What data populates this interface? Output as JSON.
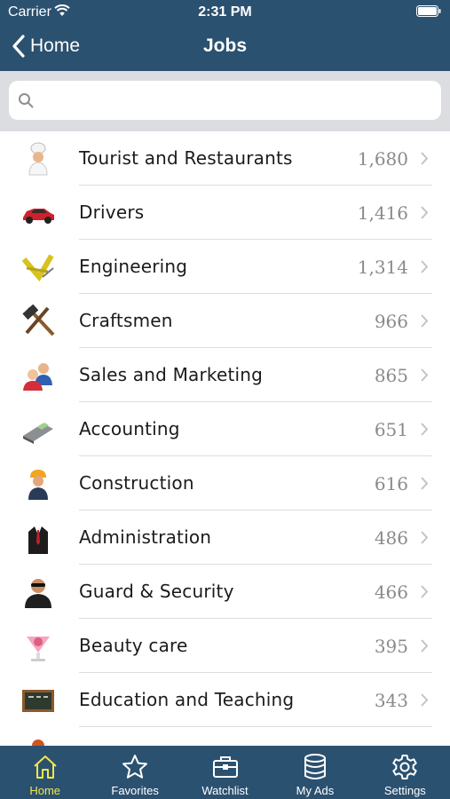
{
  "status": {
    "carrier": "Carrier",
    "time": "2:31 PM"
  },
  "nav": {
    "back_label": "Home",
    "title": "Jobs"
  },
  "search": {
    "placeholder": ""
  },
  "jobs": [
    {
      "label": "Tourist and Restaurants",
      "count": "1,680",
      "icon": "chef-icon"
    },
    {
      "label": "Drivers",
      "count": "1,416",
      "icon": "car-icon"
    },
    {
      "label": "Engineering",
      "count": "1,314",
      "icon": "drafting-tools-icon"
    },
    {
      "label": "Craftsmen",
      "count": "966",
      "icon": "hammer-icon"
    },
    {
      "label": "Sales and Marketing",
      "count": "865",
      "icon": "people-icon"
    },
    {
      "label": "Accounting",
      "count": "651",
      "icon": "calculator-icon"
    },
    {
      "label": "Construction",
      "count": "616",
      "icon": "construction-worker-icon"
    },
    {
      "label": "Administration",
      "count": "486",
      "icon": "suit-icon"
    },
    {
      "label": "Guard & Security",
      "count": "466",
      "icon": "guard-icon"
    },
    {
      "label": "Beauty care",
      "count": "395",
      "icon": "beauty-icon"
    },
    {
      "label": "Education and Teaching",
      "count": "343",
      "icon": "chalkboard-icon"
    }
  ],
  "tabs": [
    {
      "label": "Home",
      "icon": "home-icon",
      "active": true
    },
    {
      "label": "Favorites",
      "icon": "star-icon",
      "active": false
    },
    {
      "label": "Watchlist",
      "icon": "briefcase-icon",
      "active": false
    },
    {
      "label": "My Ads",
      "icon": "database-icon",
      "active": false
    },
    {
      "label": "Settings",
      "icon": "gear-icon",
      "active": false
    }
  ],
  "colors": {
    "nav_bg": "#2b5170",
    "tab_active": "#f2e64a",
    "search_bg": "#dcdde0"
  }
}
